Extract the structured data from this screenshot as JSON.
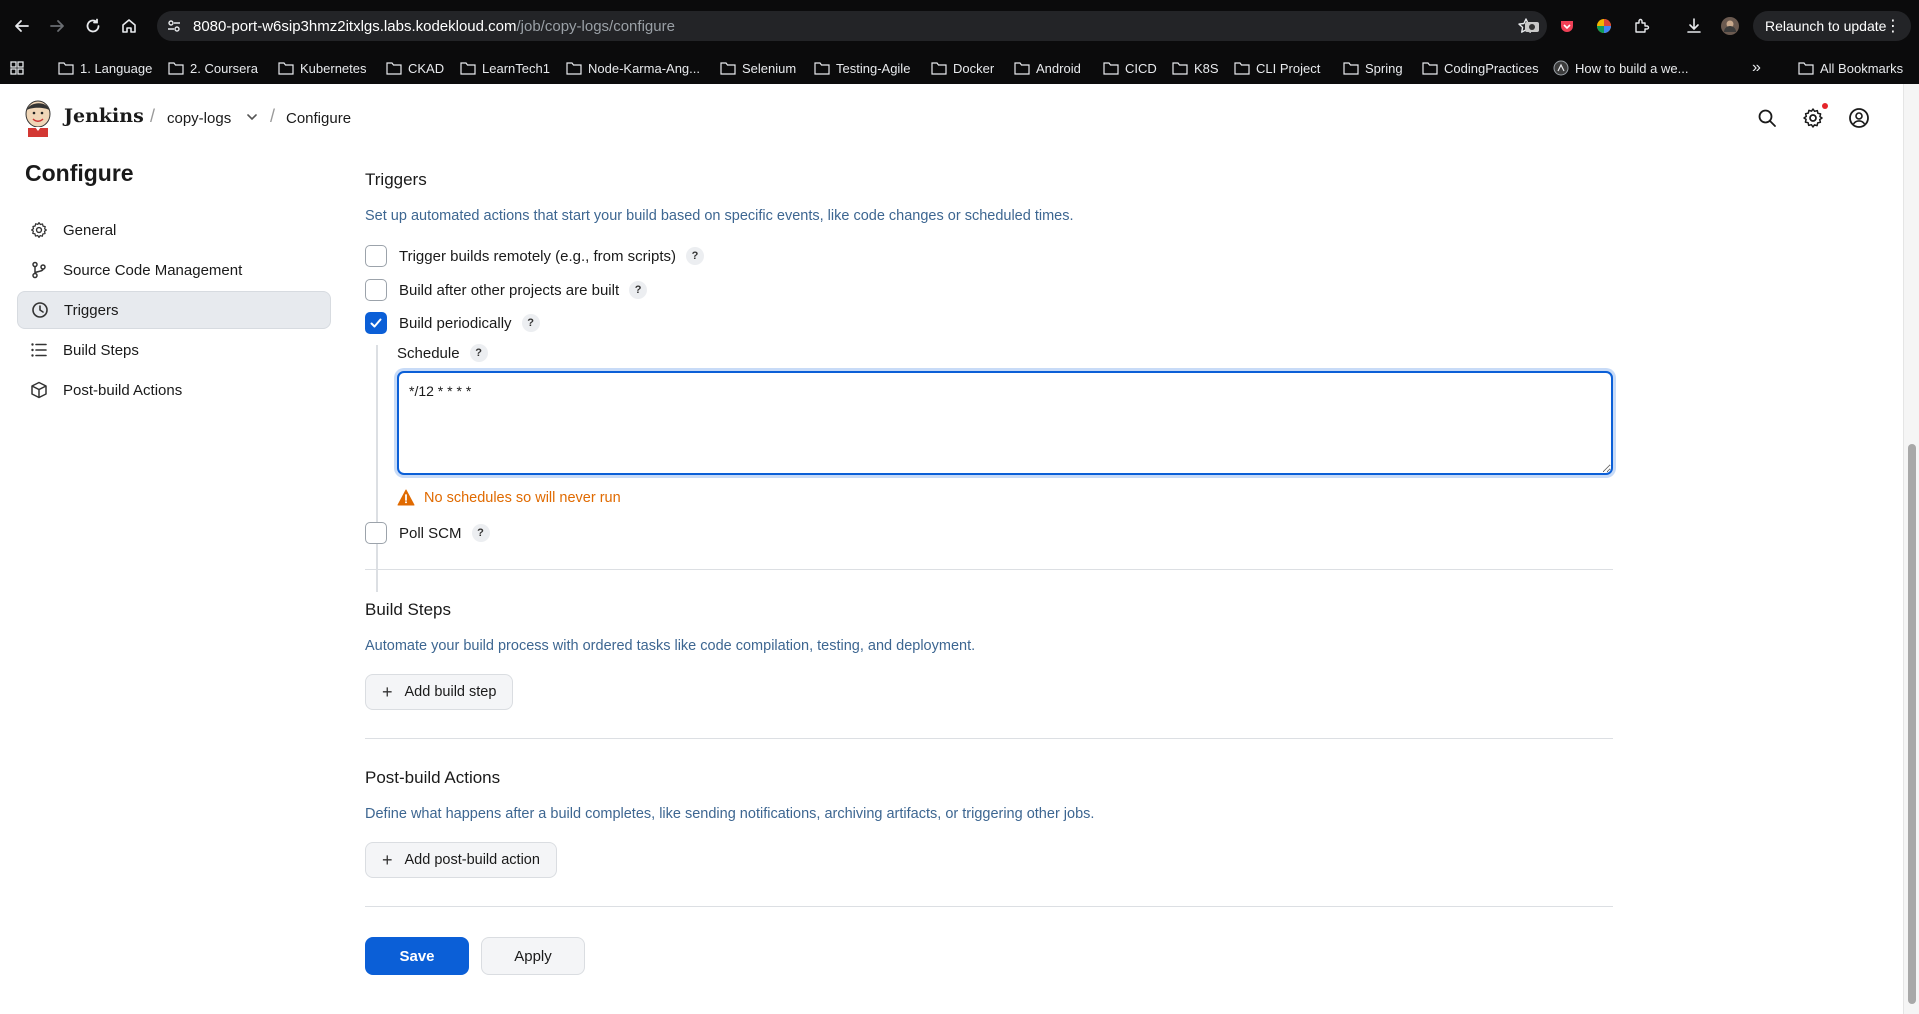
{
  "browser": {
    "url_host": "8080-port-w6sip3hmz2itxlgs.labs.kodekloud.com",
    "url_path": "/job/copy-logs/configure",
    "relaunch_label": "Relaunch to update",
    "bookmarks": [
      "1. Language",
      "2. Coursera",
      "Kubernetes",
      "CKAD",
      "LearnTech1",
      "Node-Karma-Ang...",
      "Selenium",
      "Testing-Agile",
      "Docker",
      "Android",
      "CICD",
      "K8S",
      "CLI Project",
      "Spring",
      "CodingPractices",
      "How to build a we..."
    ],
    "all_bookmarks_label": "All Bookmarks",
    "more_label": "»"
  },
  "header": {
    "brand": "Jenkins",
    "separator": "/",
    "job_name": "copy-logs",
    "page": "Configure"
  },
  "sidebar": {
    "title": "Configure",
    "items": [
      {
        "label": "General",
        "icon": "gear-icon"
      },
      {
        "label": "Source Code Management",
        "icon": "branch-icon"
      },
      {
        "label": "Triggers",
        "icon": "clock-icon"
      },
      {
        "label": "Build Steps",
        "icon": "list-icon"
      },
      {
        "label": "Post-build Actions",
        "icon": "package-icon"
      }
    ],
    "active_index": 2
  },
  "triggers": {
    "title": "Triggers",
    "description": "Set up automated actions that start your build based on specific events, like code changes or scheduled times.",
    "options": [
      {
        "label": "Trigger builds remotely (e.g., from scripts)",
        "checked": false
      },
      {
        "label": "Build after other projects are built",
        "checked": false
      },
      {
        "label": "Build periodically",
        "checked": true
      },
      {
        "label": "Poll SCM",
        "checked": false
      }
    ],
    "help_glyph": "?",
    "schedule": {
      "label": "Schedule",
      "value": "*/12 * * * *",
      "warning": "No schedules so will never run"
    }
  },
  "build_steps": {
    "title": "Build Steps",
    "description": "Automate your build process with ordered tasks like code compilation, testing, and deployment.",
    "add_label": "Add build step"
  },
  "post_build": {
    "title": "Post-build Actions",
    "description": "Define what happens after a build completes, like sending notifications, archiving artifacts, or triggering other jobs.",
    "add_label": "Add post-build action"
  },
  "actions": {
    "save_label": "Save",
    "apply_label": "Apply"
  },
  "colors": {
    "accent": "#0b5fd7",
    "warning": "#e06a00",
    "description": "#3d6691"
  }
}
